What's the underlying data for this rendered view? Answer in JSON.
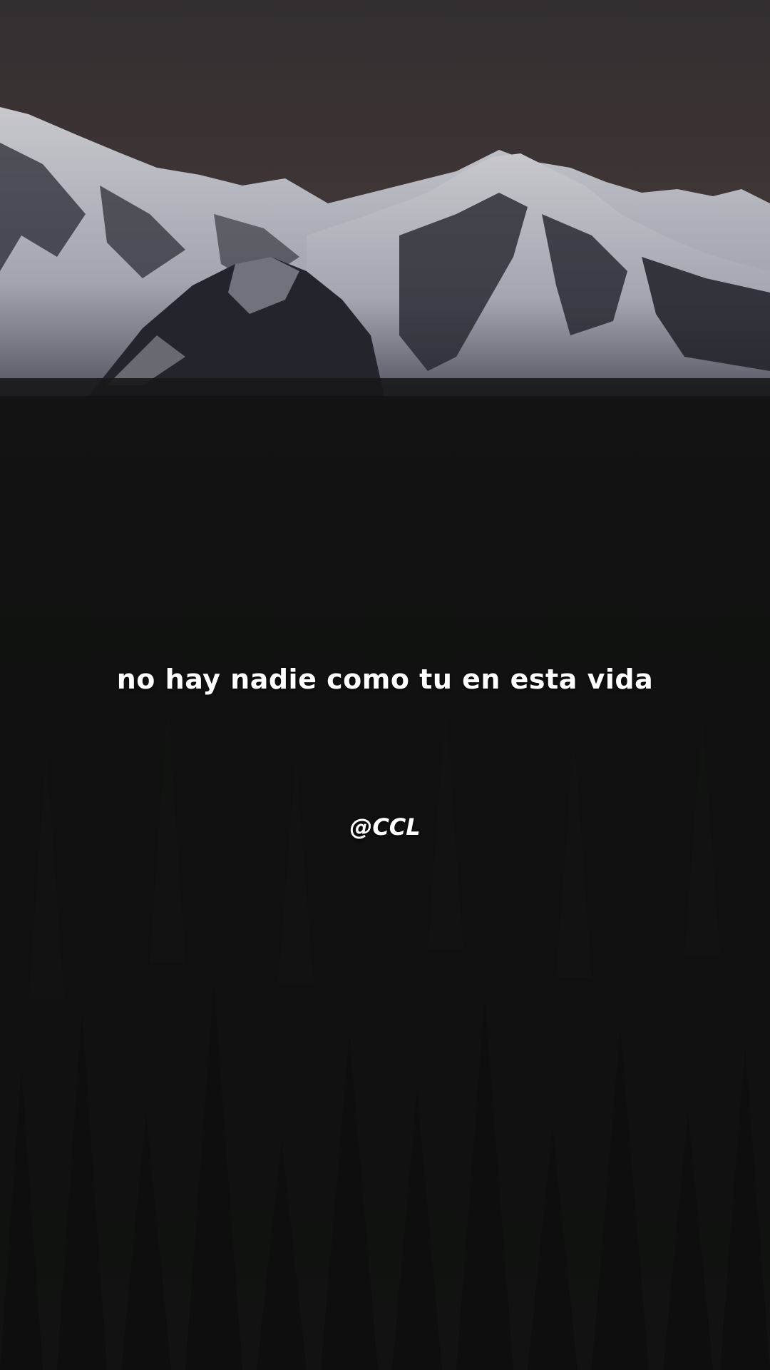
{
  "caption": "no hay nadie como tu en esta vida",
  "handle": "@CCL",
  "colors": {
    "sky": "#453c3d",
    "snow": "#d9dbe3",
    "rock": "#262630",
    "field": "#121312",
    "text": "#ffffff"
  }
}
